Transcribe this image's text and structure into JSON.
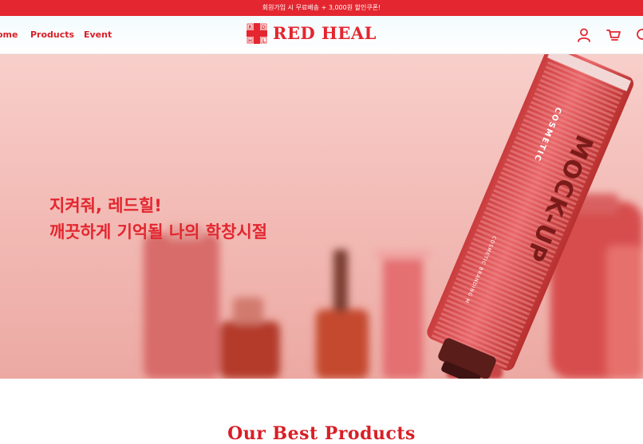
{
  "announcement": "회원가입 시 무료배송 + 3,000원 할인쿠폰!",
  "nav": {
    "items": [
      "ome",
      "Products",
      "Event"
    ]
  },
  "logo": {
    "text": "RED HEAL",
    "mark_letters": [
      "R",
      "D",
      "H",
      "L"
    ]
  },
  "header_icons": [
    "user-icon",
    "cart-icon",
    "search-icon"
  ],
  "hero": {
    "headline_line1": "지켜줘, 레드힐!",
    "headline_line2": "깨끗하게 기억될 나의 학창시절",
    "tube_label_main": "MOCK-UP",
    "tube_label_side": "COSMETIC",
    "tube_label_small": "COSMETIC BRANDING M"
  },
  "best_products": {
    "title": "Our Best Products"
  },
  "colors": {
    "brand_red": "#e3262f",
    "hero_pink": "#f5c2bd"
  }
}
